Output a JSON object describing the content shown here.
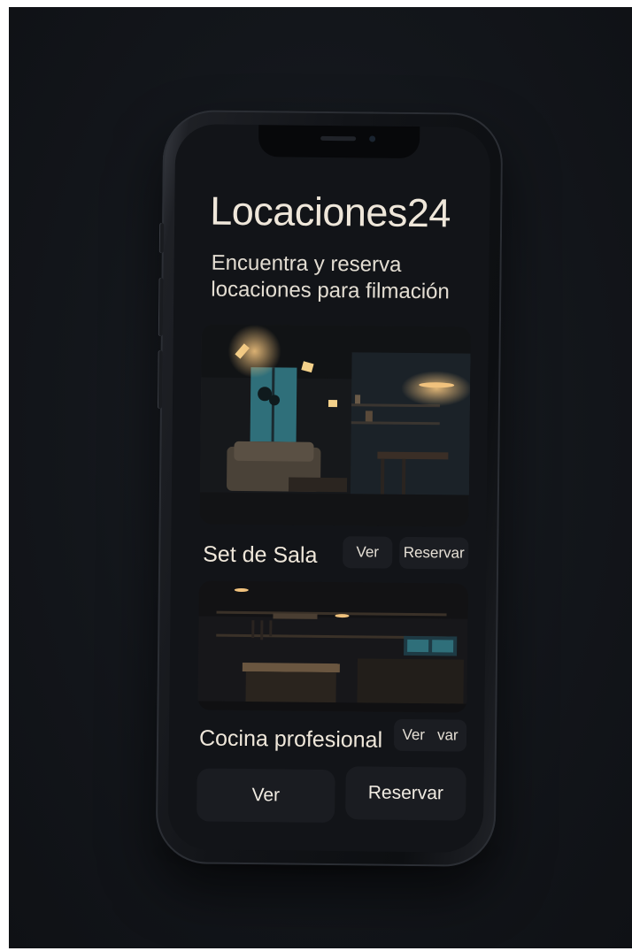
{
  "app": {
    "title": "Locaciones24",
    "subtitle": "Encuentra y reserva locaciones para filmación"
  },
  "locations": [
    {
      "name": "Set de Sala",
      "view_label": "Ver",
      "book_label": "Reservar",
      "image": "living-room-set-photo"
    },
    {
      "name": "Cocina profesional",
      "view_label": "Ver",
      "book_label": "var",
      "image": "professional-kitchen-photo"
    }
  ],
  "bottom_actions": {
    "view_label": "Ver",
    "book_label": "Reservar"
  },
  "colors": {
    "background": "#13161b",
    "phone_body": "#121418",
    "screen": "#121418",
    "text_primary": "#efe7da",
    "button_bg": "#1b1d22",
    "warm_light": "#e7b36a",
    "window_teal": "#2f6f7a"
  }
}
